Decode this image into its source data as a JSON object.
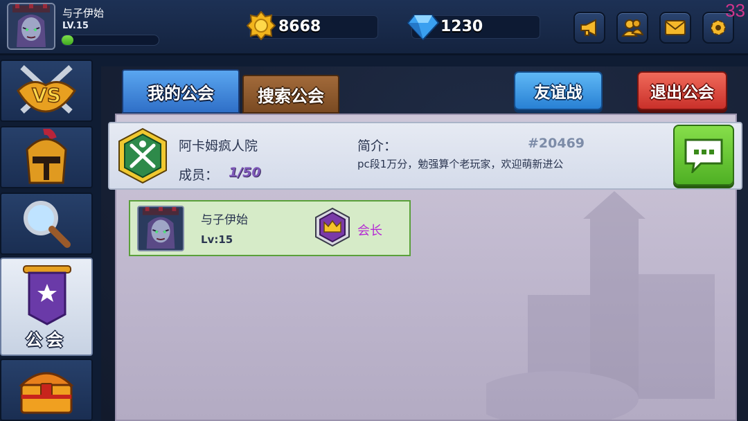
{
  "player": {
    "name": "与子伊始",
    "level_text": "LV.15",
    "xp_fraction": 0.12
  },
  "resources": {
    "gold": "8668",
    "gems": "1230"
  },
  "top_buttons": [
    "megaphone-icon",
    "friends-icon",
    "mail-icon",
    "settings-icon"
  ],
  "fps": "33",
  "nav": {
    "items": [
      {
        "name": "battle",
        "icon": "vs-icon"
      },
      {
        "name": "heroes",
        "icon": "helmet-icon"
      },
      {
        "name": "search",
        "icon": "magnifier-icon"
      },
      {
        "name": "guild",
        "icon": "guild-banner-icon",
        "label": "公会",
        "active": true
      },
      {
        "name": "chest",
        "icon": "treasure-chest-icon"
      }
    ]
  },
  "tabs": {
    "my_guild": "我的公会",
    "search_guild": "搜索公会"
  },
  "actions": {
    "friendly_battle": "友谊战",
    "leave_guild": "退出公会"
  },
  "guild": {
    "name": "阿卡姆疯人院",
    "members_label": "成员：",
    "members_value": "1/50",
    "intro_label": "简介：",
    "id": "#20469",
    "description": "pc段1万分，勉强算个老玩家，欢迎萌新进公"
  },
  "members": [
    {
      "name": "与子伊始",
      "level": "Lv:15",
      "role": "会长"
    }
  ],
  "colors": {
    "role_leader": "#b52bd4",
    "members_value": "#7e58b8",
    "friendly_btn": "#2880d4",
    "leave_btn": "#c9302a",
    "chat_btn": "#4fb024"
  }
}
